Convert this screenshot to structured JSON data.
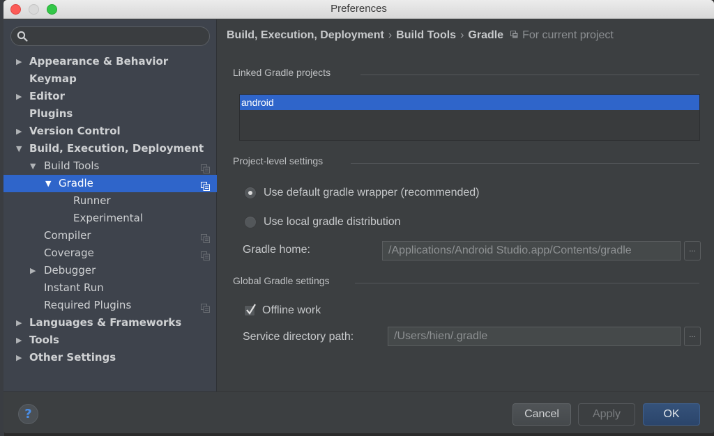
{
  "window": {
    "title": "Preferences"
  },
  "search": {
    "placeholder": "",
    "icon": "search-icon"
  },
  "sidebar": {
    "items": [
      {
        "label": "Appearance & Behavior",
        "level": 0,
        "arrow": "▶",
        "bold": true,
        "project_icon": false,
        "selected": false
      },
      {
        "label": "Keymap",
        "level": 0,
        "arrow": "",
        "bold": true,
        "project_icon": false,
        "selected": false
      },
      {
        "label": "Editor",
        "level": 0,
        "arrow": "▶",
        "bold": true,
        "project_icon": false,
        "selected": false
      },
      {
        "label": "Plugins",
        "level": 0,
        "arrow": "",
        "bold": true,
        "project_icon": false,
        "selected": false
      },
      {
        "label": "Version Control",
        "level": 0,
        "arrow": "▶",
        "bold": true,
        "project_icon": false,
        "selected": false
      },
      {
        "label": "Build, Execution, Deployment",
        "level": 0,
        "arrow": "▼",
        "bold": true,
        "project_icon": false,
        "selected": false
      },
      {
        "label": "Build Tools",
        "level": 1,
        "arrow": "▼",
        "bold": false,
        "project_icon": true,
        "selected": false
      },
      {
        "label": "Gradle",
        "level": 2,
        "arrow": "▼",
        "bold": false,
        "project_icon": true,
        "selected": true
      },
      {
        "label": "Runner",
        "level": 3,
        "arrow": "",
        "bold": false,
        "project_icon": false,
        "selected": false
      },
      {
        "label": "Experimental",
        "level": 3,
        "arrow": "",
        "bold": false,
        "project_icon": false,
        "selected": false
      },
      {
        "label": "Compiler",
        "level": 1,
        "arrow": "",
        "bold": false,
        "project_icon": true,
        "selected": false
      },
      {
        "label": "Coverage",
        "level": 1,
        "arrow": "",
        "bold": false,
        "project_icon": true,
        "selected": false
      },
      {
        "label": "Debugger",
        "level": 1,
        "arrow": "▶",
        "bold": false,
        "project_icon": false,
        "selected": false
      },
      {
        "label": "Instant Run",
        "level": 1,
        "arrow": "",
        "bold": false,
        "project_icon": false,
        "selected": false
      },
      {
        "label": "Required Plugins",
        "level": 1,
        "arrow": "",
        "bold": false,
        "project_icon": true,
        "selected": false
      },
      {
        "label": "Languages & Frameworks",
        "level": 0,
        "arrow": "▶",
        "bold": true,
        "project_icon": false,
        "selected": false
      },
      {
        "label": "Tools",
        "level": 0,
        "arrow": "▶",
        "bold": true,
        "project_icon": false,
        "selected": false
      },
      {
        "label": "Other Settings",
        "level": 0,
        "arrow": "▶",
        "bold": true,
        "project_icon": false,
        "selected": false
      }
    ]
  },
  "breadcrumb": {
    "parts": [
      "Build, Execution, Deployment",
      "Build Tools",
      "Gradle"
    ],
    "separator": "›",
    "scope": "For current project"
  },
  "linked_projects": {
    "title": "Linked Gradle projects",
    "items": [
      "android"
    ],
    "selected": "android"
  },
  "project_settings": {
    "title": "Project-level settings",
    "options": [
      {
        "label": "Use default gradle wrapper (recommended)",
        "checked": true
      },
      {
        "label": "Use local gradle distribution",
        "checked": false
      }
    ],
    "gradle_home_label": "Gradle home:",
    "gradle_home_value": "/Applications/Android Studio.app/Contents/gradle",
    "browse_label": "..."
  },
  "global_settings": {
    "title": "Global Gradle settings",
    "offline_work_label": "Offline work",
    "offline_work_checked": true,
    "service_dir_label": "Service directory path:",
    "service_dir_value": "/Users/hien/.gradle",
    "browse_label": "..."
  },
  "footer": {
    "help_label": "?",
    "cancel_label": "Cancel",
    "apply_label": "Apply",
    "ok_label": "OK"
  },
  "colors": {
    "selection": "#2f65ca",
    "sidebar_bg": "#3e434c",
    "content_bg": "#3c3f41",
    "ok_button": "#2f4a70"
  }
}
